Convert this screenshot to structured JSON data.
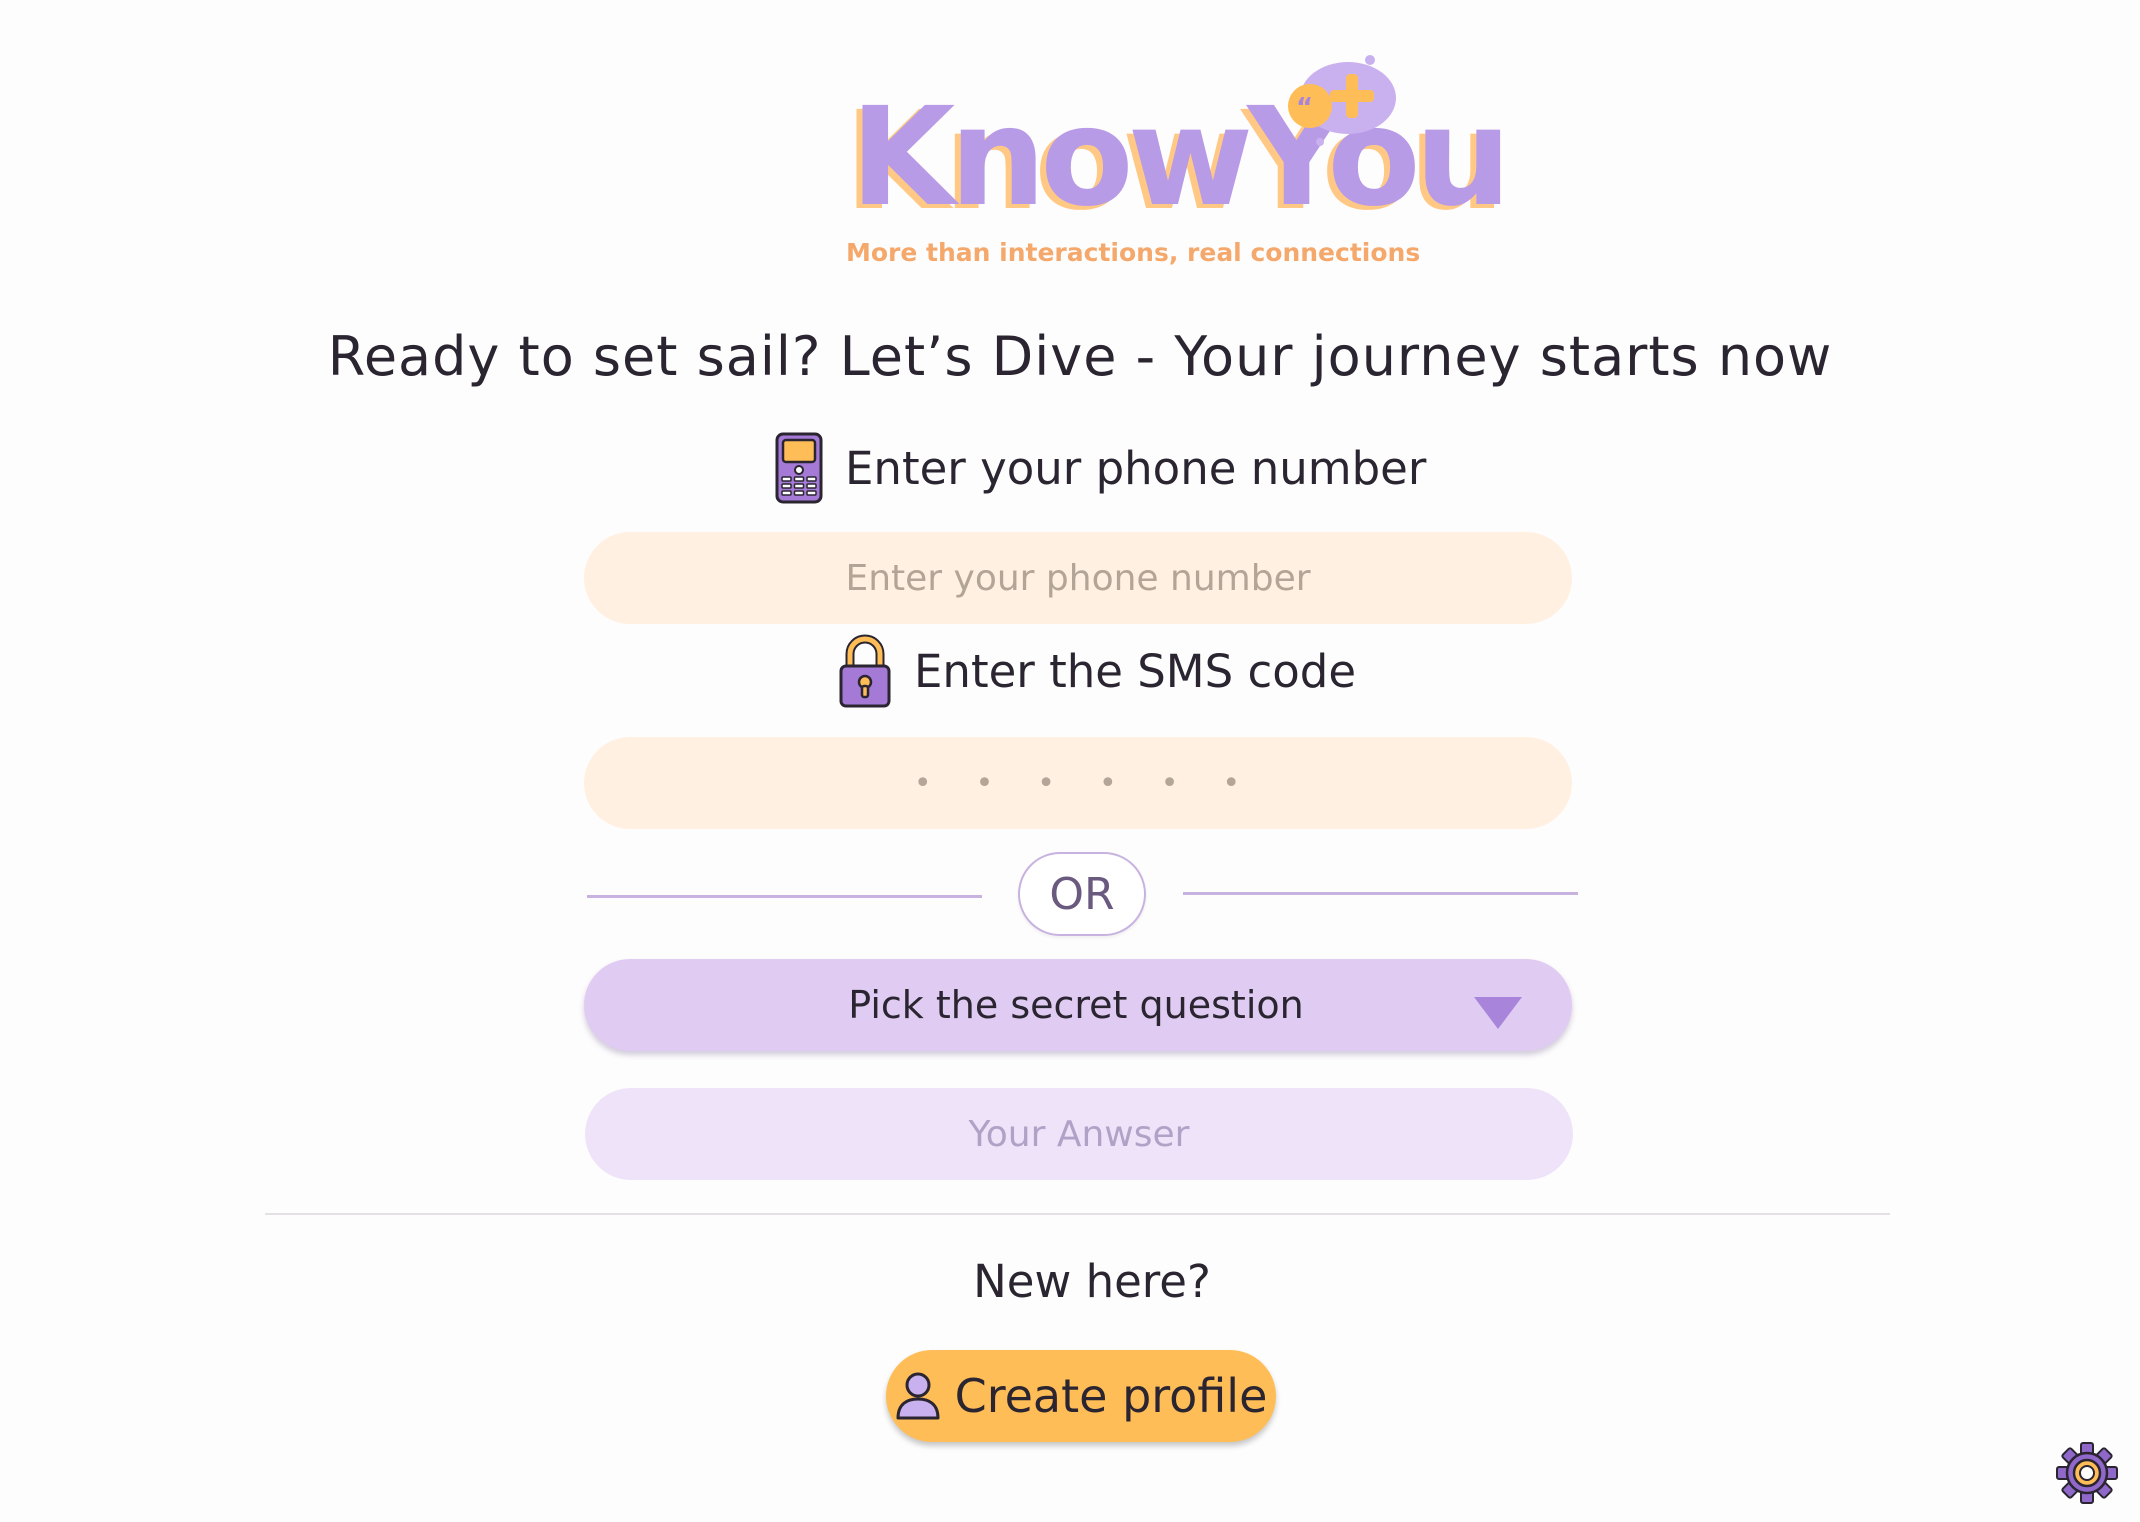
{
  "logo": {
    "wordmark": "KnowYou",
    "tagline": "More than interactions, real connections"
  },
  "heading": "Ready to set sail? Let’s Dive - Your journey starts now",
  "phone": {
    "label": "Enter your phone number",
    "placeholder": "Enter your phone number",
    "icon": "mobile-phone-icon"
  },
  "sms": {
    "label": "Enter the SMS code",
    "placeholder": "••••••",
    "icon": "padlock-icon"
  },
  "divider": {
    "label": "OR"
  },
  "secret_question": {
    "label": "Pick the secret question",
    "icon": "dropdown-arrow-icon"
  },
  "answer": {
    "placeholder": "Your Anwser"
  },
  "signup": {
    "prompt": "New here?",
    "button_label": "Create profile",
    "icon": "user-icon"
  },
  "settings": {
    "icon": "gear-icon"
  },
  "colors": {
    "brand_purple": "#b89be6",
    "brand_orange": "#ffbd57",
    "input_peach": "#fff0e1",
    "select_lavender": "#e0ccf2",
    "answer_lavender": "#efe3f9"
  }
}
